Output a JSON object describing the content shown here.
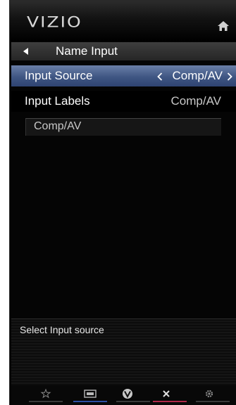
{
  "header": {
    "logo_text": "VIZIO",
    "home_icon": "home-icon"
  },
  "nav": {
    "back_icon": "triangle-left-icon",
    "title": "Name Input"
  },
  "menu": {
    "items": [
      {
        "label": "Input Source",
        "value": "Comp/AV",
        "selected": true
      },
      {
        "label": "Input Labels",
        "value": "Comp/AV",
        "selected": false
      }
    ]
  },
  "name_field": {
    "value": "Comp/AV"
  },
  "help": {
    "text": "Select Input source"
  },
  "bottom_bar": {
    "buttons": [
      {
        "icon": "star-icon",
        "underline_color": "#3b3b3b"
      },
      {
        "icon": "input-icon",
        "underline_color": "#2d4fa5"
      },
      {
        "icon": "vizio-v-icon",
        "underline_color": "#3b3b3b"
      },
      {
        "icon": "close-icon",
        "underline_color": "#b0284a"
      },
      {
        "icon": "gear-icon",
        "underline_color": "#3b3b3b"
      }
    ]
  },
  "colors": {
    "selected_row": "#3f5683",
    "background": "#050505",
    "text": "#ffffff"
  }
}
